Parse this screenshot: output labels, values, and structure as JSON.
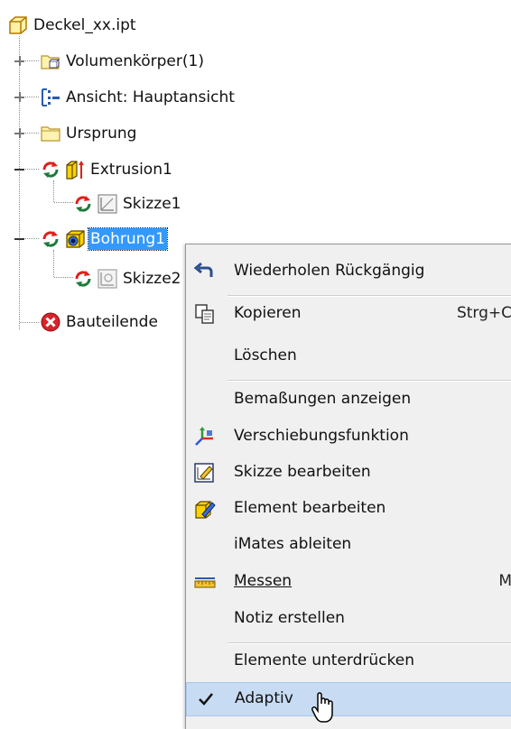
{
  "tree": {
    "root": "Deckel_xx.ipt",
    "items": [
      {
        "label": "Volumenkörper(1)"
      },
      {
        "label": "Ansicht: Hauptansicht"
      },
      {
        "label": "Ursprung"
      },
      {
        "label": "Extrusion1"
      },
      {
        "label": "Skizze1"
      },
      {
        "label": "Bohrung1",
        "selected": true
      },
      {
        "label": "Skizze2"
      },
      {
        "label": "Bauteilende"
      }
    ]
  },
  "context_menu": {
    "items": [
      {
        "label": "Wiederholen Rückgängig",
        "icon": "redo-undo-icon"
      },
      {
        "label": "Kopieren",
        "shortcut": "Strg+C",
        "icon": "copy-icon"
      },
      {
        "label": "Löschen"
      },
      {
        "label": "Bemaßungen anzeigen"
      },
      {
        "label": "Verschiebungsfunktion",
        "icon": "move-triad-icon"
      },
      {
        "label": "Skizze bearbeiten",
        "icon": "edit-sketch-icon"
      },
      {
        "label": "Element bearbeiten",
        "icon": "edit-feature-icon"
      },
      {
        "label": "iMates ableiten"
      },
      {
        "label": "Messen",
        "shortcut": "M",
        "icon": "measure-ruler-icon"
      },
      {
        "label": "Notiz erstellen"
      },
      {
        "label": "Elemente unterdrücken"
      },
      {
        "label": "Adaptiv",
        "checked": true,
        "hovered": true,
        "icon": "checkmark-icon"
      }
    ]
  },
  "colors": {
    "selection": "#3399ff",
    "menu_hover": "#c7dbf2",
    "menu_bg": "#f0f0f0"
  }
}
